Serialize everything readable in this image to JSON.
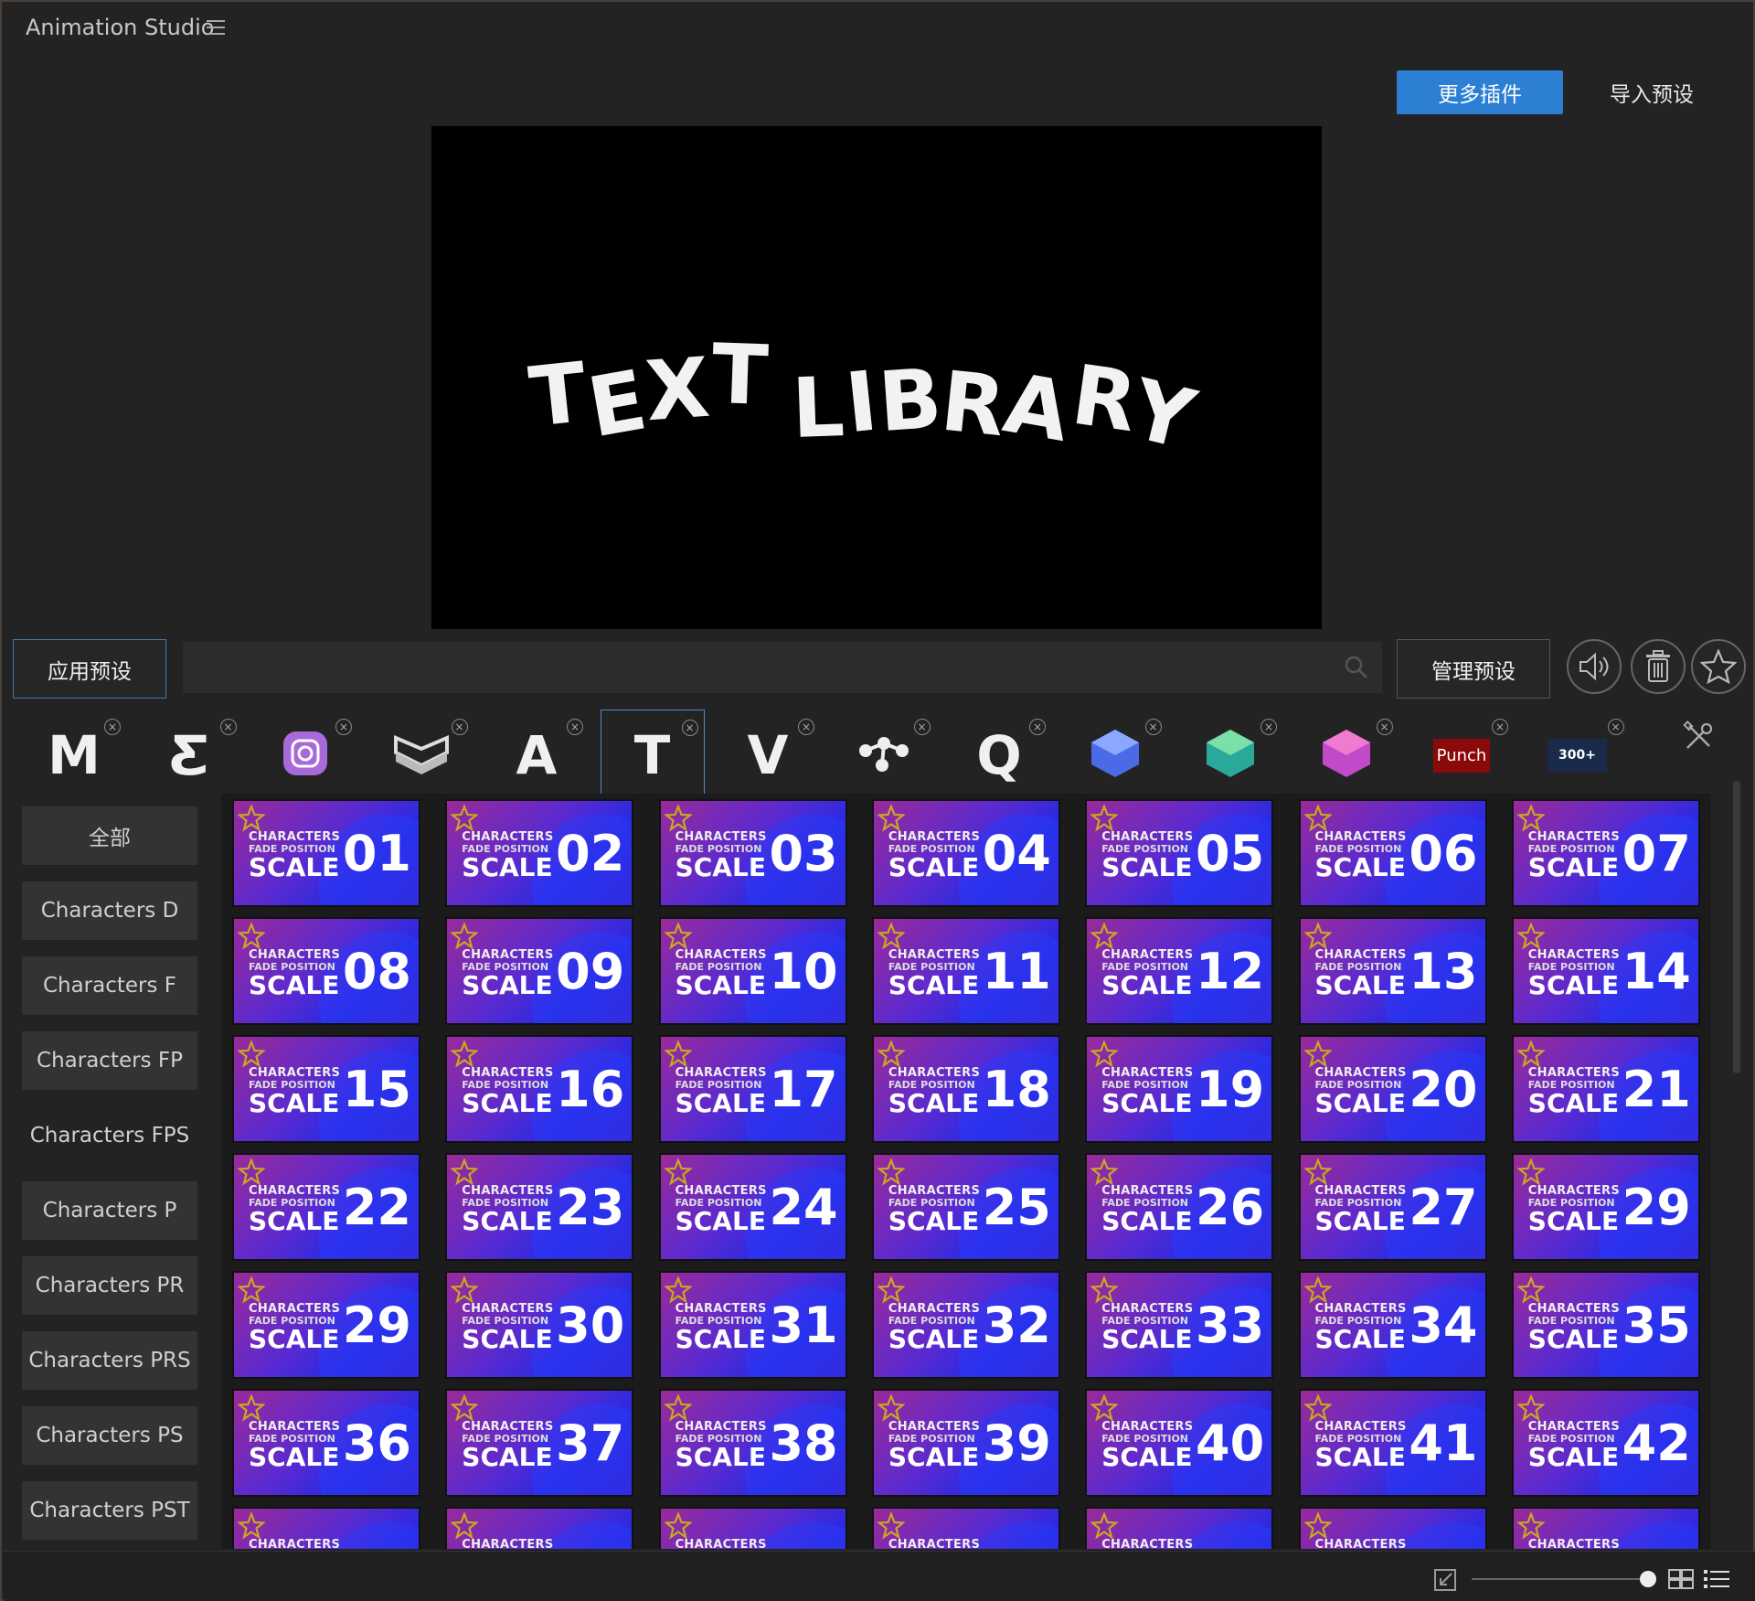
{
  "app": {
    "title": "Animation Studio"
  },
  "header": {
    "more_plugins": "更多插件",
    "import_presets": "导入预设"
  },
  "preview": {
    "letters": [
      "T",
      "E",
      "X",
      "T",
      "L",
      "I",
      "B",
      "R",
      "A",
      "R",
      "Y"
    ]
  },
  "toolbar": {
    "apply_presets": "应用预设",
    "search_placeholder": "",
    "manage_presets": "管理预设"
  },
  "plugins": [
    {
      "name": "m-logo-icon",
      "glyph": "M"
    },
    {
      "name": "e-logo-icon",
      "glyph": "Ƹ"
    },
    {
      "name": "camera-app-icon",
      "glyph": ""
    },
    {
      "name": "layers-icon",
      "glyph": ""
    },
    {
      "name": "a-logo-icon",
      "glyph": "A"
    },
    {
      "name": "t-logo-icon",
      "glyph": "T"
    },
    {
      "name": "v-logo-icon",
      "glyph": "V"
    },
    {
      "name": "molecule-icon",
      "glyph": ""
    },
    {
      "name": "q-logo-icon",
      "glyph": "Q"
    },
    {
      "name": "blue-cube-icon",
      "glyph": ""
    },
    {
      "name": "green-cube-icon",
      "glyph": ""
    },
    {
      "name": "pink-cube-icon",
      "glyph": ""
    },
    {
      "name": "punch-logo-icon",
      "glyph": "Punch"
    },
    {
      "name": "pack-300-icon",
      "glyph": "300+"
    }
  ],
  "categories": [
    {
      "label": "全部",
      "style": "box"
    },
    {
      "label": "Characters D",
      "style": "box"
    },
    {
      "label": "Characters F",
      "style": "box"
    },
    {
      "label": "Characters FP",
      "style": "box"
    },
    {
      "label": "Characters FPS",
      "style": "plain"
    },
    {
      "label": "Characters P",
      "style": "box"
    },
    {
      "label": "Characters PR",
      "style": "box"
    },
    {
      "label": "Characters PRS",
      "style": "box"
    },
    {
      "label": "Characters PS",
      "style": "box"
    },
    {
      "label": "Characters PST",
      "style": "box"
    }
  ],
  "tile_text": {
    "line1": "CHARACTERS",
    "line2": "FADE POSITION",
    "line3": "SCALE"
  },
  "tiles": [
    "01",
    "02",
    "03",
    "04",
    "05",
    "06",
    "07",
    "08",
    "09",
    "10",
    "11",
    "12",
    "13",
    "14",
    "15",
    "16",
    "17",
    "18",
    "19",
    "20",
    "21",
    "22",
    "23",
    "24",
    "25",
    "26",
    "27",
    "29",
    "29",
    "30",
    "31",
    "32",
    "33",
    "34",
    "35",
    "36",
    "37",
    "38",
    "39",
    "40",
    "41",
    "42",
    "",
    "",
    "",
    "",
    "",
    "",
    ""
  ],
  "colors": {
    "accent": "#2d7fd4",
    "tile_pink": "#9a2a9a",
    "tile_blue": "#2a2ae0",
    "star": "#c8a820"
  }
}
